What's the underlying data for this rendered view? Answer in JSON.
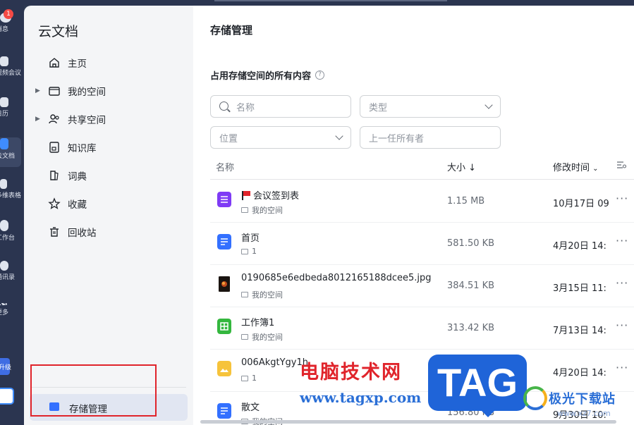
{
  "rail": {
    "badge": "1",
    "items": [
      {
        "label": "消息"
      },
      {
        "label": "视频会议"
      },
      {
        "label": "日历"
      },
      {
        "label": "云文档"
      },
      {
        "label": "多维表格"
      },
      {
        "label": "工作台"
      },
      {
        "label": "通讯录"
      },
      {
        "label": "更多"
      },
      {
        "label": "升级"
      }
    ]
  },
  "sidebar": {
    "title": "云文档",
    "items": [
      {
        "label": "主页",
        "icon": "home-icon"
      },
      {
        "label": "我的空间",
        "icon": "folder-icon"
      },
      {
        "label": "共享空间",
        "icon": "people-icon"
      },
      {
        "label": "知识库",
        "icon": "book-icon"
      },
      {
        "label": "词典",
        "icon": "dictionary-icon"
      },
      {
        "label": "收藏",
        "icon": "star-icon"
      },
      {
        "label": "回收站",
        "icon": "trash-icon"
      }
    ],
    "storage_label": "存储管理"
  },
  "main": {
    "title": "存储管理",
    "section_title": "占用存储空间的所有内容",
    "filters": {
      "name_placeholder": "名称",
      "type_placeholder": "类型",
      "location_placeholder": "位置",
      "owner_placeholder": "上一任所有者"
    },
    "columns": {
      "name": "名称",
      "size": "大小",
      "modified": "修改时间"
    },
    "rows": [
      {
        "name": "会议签到表",
        "location": "我的空间",
        "size": "1.15 MB",
        "modified": "10月17日 09",
        "icon_color": "#7f3bf5",
        "flag": true
      },
      {
        "name": "首页",
        "location": "1",
        "size": "581.50 KB",
        "modified": "4月20日 14:",
        "icon_color": "#3370ff"
      },
      {
        "name": "0190685e6edbeda8012165188dcee5.jpg",
        "location": "我的空间",
        "size": "384.51 KB",
        "modified": "3月15日 11:",
        "icon_color": "#1f2329"
      },
      {
        "name": "工作簿1",
        "location": "我的空间",
        "size": "313.42 KB",
        "modified": "7月13日 14:",
        "icon_color": "#34b73e"
      },
      {
        "name": "006AkgtYgy1h",
        "location": "1",
        "size": "",
        "modified": "4月20日 14:",
        "icon_color": "#f6c33b"
      },
      {
        "name": "散文",
        "location": "我的空间",
        "size": "156.80 KB",
        "modified": "9月30日 10:",
        "icon_color": "#3370ff"
      }
    ]
  },
  "watermark": {
    "text": "电脑技术网",
    "url": "www.tagxp.com",
    "tag": "TAG",
    "brand": "极光下载站",
    "brand_url": "www.xz7.com"
  }
}
